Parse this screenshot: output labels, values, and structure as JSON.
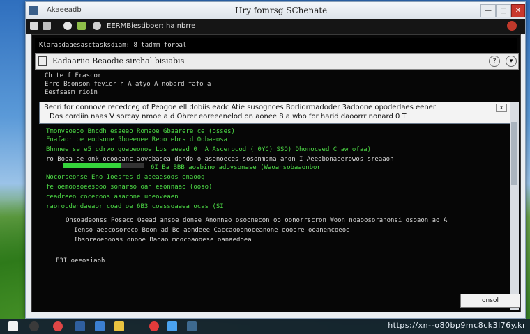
{
  "window": {
    "left_label": "Akaeeadb",
    "title": "Hry fomrsg SChenate",
    "buttons": {
      "minimize": "—",
      "maximize": "□",
      "close": "✕"
    }
  },
  "toolbar": {
    "address": "EERMBiestiboer: ha nbrre",
    "second_line": "Klarasdaaesasctasksdiam: 8 tadmm foroal"
  },
  "console_head": {
    "title": "Eadaariio   Beaodie sirchal bisiabis"
  },
  "console_lines": [
    {
      "text": "Ch te f Frascor",
      "color": "white"
    },
    {
      "text": "Erro Bsonson fevier h A atyo A nobard fafo a",
      "color": "white"
    },
    {
      "text": "Eesfsasm rioin",
      "color": "white"
    }
  ],
  "dialog": {
    "line1": "Becri  for oonnove  recedceg of   Peogoe ell dobiis eadc Atie  susognces  Borliormadoder  3adoone  opoderlaes  eener",
    "line2": "Dos  cordiin naas  V sorcay   nmoe  a  d Ohrer  eoreeenelod on  aonee  8  a  wbo  for  harid  daoorrr  nonard  0  T"
  },
  "output_lines": [
    {
      "text": "Tmonvsoeoo  Bncdh esaeeo   Romaoe Gbaarere ce (osses)",
      "color": "green"
    },
    {
      "text": "Fnafaor oe eodsone  5boeenee  Reoo ebrs d Oobaeosa",
      "color": "green"
    },
    {
      "text": "Bhnnee se e5 cdrwo  goabeonoe Los aeead  0| A Ascerocod ( 0YC) SSO) Dhonoceed C aw  ofaa)",
      "color": "green"
    },
    {
      "text": "ro  Booa ee onk ocoooanc  aovebasea dondo o asenoeces sosonmsna anon I  Aeeobonaeerowos sreaaon",
      "color": "white"
    },
    {
      "text": "6I  Ba BBB aosbino adovsonase (Waoansobaaonbor",
      "color": "green"
    },
    {
      "text": "Nocorseonse Eno  Ioesres d aoeaesoos enaoog",
      "color": "green"
    },
    {
      "text": "fe oemooaoeesooo sonarso oan eeonnaao (ooso)",
      "color": "green"
    },
    {
      "text": "ceadreeo cocecoos asacone uoeoveaen",
      "color": "green"
    },
    {
      "text": "raorocdendaeaor  coad oe 6B3 coassoaaea ocas (SI",
      "color": "green"
    },
    {
      "text": "Onsoadeonss  Poseco  Oeead ansoe donee Anonnao osoonecon oo oonorrscron  Woon noaoosoranonsi osoaon ao  A",
      "color": "white"
    },
    {
      "text": "Ienso aeocosoreco Boon ad Be aondeee  Caccaooonoceanone eooore  ooanencoeoe",
      "color": "white"
    },
    {
      "text": "Ibsoreoeoooss onooe  Baoao moocoaooese  oanaedoea",
      "color": "white"
    },
    {
      "text": "E3I oeeosiaoh",
      "color": "white"
    }
  ],
  "progress": {
    "value": 0.72
  },
  "small_button": {
    "label": "onsol"
  },
  "taskbar": {
    "watermark": "https://xn--o80bp9mc8ck3l76y.kr"
  },
  "colors": {
    "console_bg": "#060606",
    "green_text": "#4ddb46",
    "close_red": "#c8382d"
  }
}
